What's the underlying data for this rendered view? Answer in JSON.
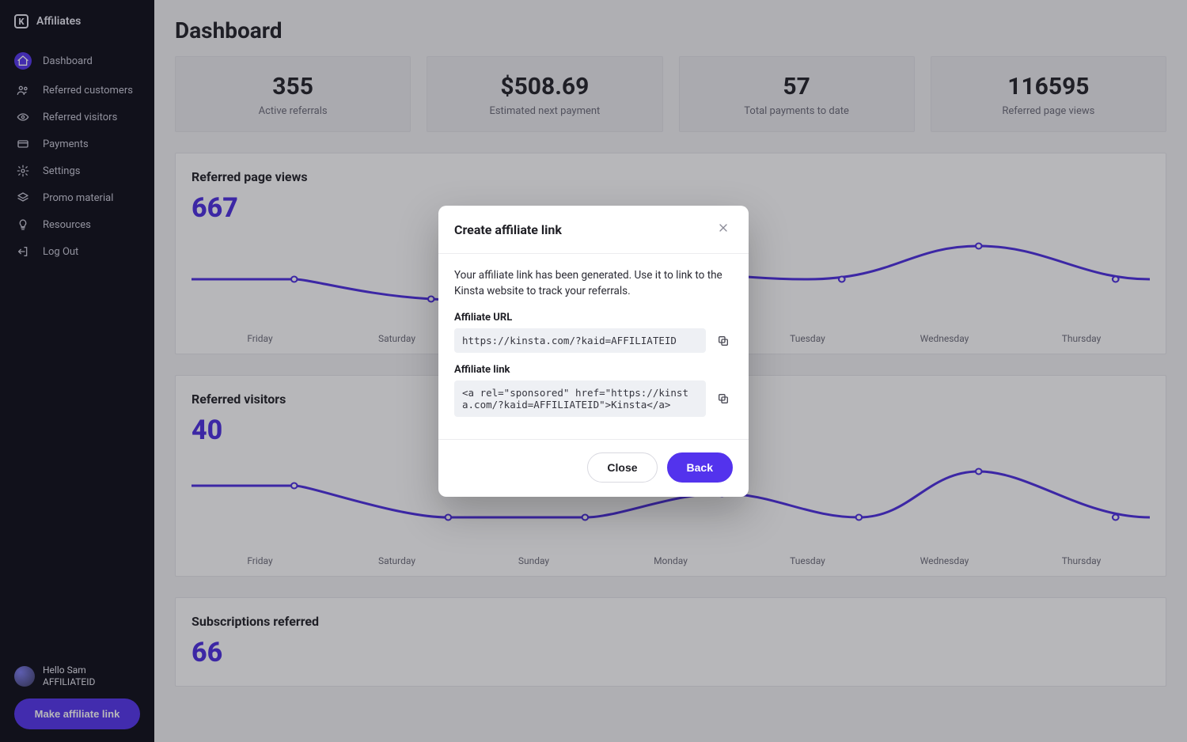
{
  "brand": {
    "name": "Affiliates"
  },
  "sidebar": {
    "items": [
      {
        "label": "Dashboard"
      },
      {
        "label": "Referred customers"
      },
      {
        "label": "Referred visitors"
      },
      {
        "label": "Payments"
      },
      {
        "label": "Settings"
      },
      {
        "label": "Promo material"
      },
      {
        "label": "Resources"
      },
      {
        "label": "Log Out"
      }
    ],
    "user": {
      "greeting": "Hello Sam",
      "id": "AFFILIATEID"
    },
    "make_link_label": "Make affiliate link"
  },
  "main": {
    "title": "Dashboard",
    "stats": [
      {
        "value": "355",
        "label": "Active referrals"
      },
      {
        "value": "$508.69",
        "label": "Estimated next payment"
      },
      {
        "value": "57",
        "label": "Total payments to date"
      },
      {
        "value": "116595",
        "label": "Referred page views"
      }
    ],
    "days": [
      "Friday",
      "Saturday",
      "Sunday",
      "Monday",
      "Tuesday",
      "Wednesday",
      "Thursday"
    ],
    "panels": {
      "page_views": {
        "title": "Referred page views",
        "value": "667"
      },
      "visitors": {
        "title": "Referred visitors",
        "value": "40"
      },
      "subscriptions": {
        "title": "Subscriptions referred",
        "value": "66"
      }
    }
  },
  "modal": {
    "title": "Create affiliate link",
    "desc": "Your affiliate link has been generated. Use it to link to the Kinsta website to track your referrals.",
    "url_label": "Affiliate URL",
    "url_value": "https://kinsta.com/?kaid=AFFILIATEID",
    "link_label": "Affiliate link",
    "link_value": "<a rel=\"sponsored\" href=\"https://kinsta.com/?kaid=AFFILIATEID\">Kinsta</a>",
    "close_label": "Close",
    "back_label": "Back"
  },
  "chart_data": [
    {
      "type": "line",
      "title": "Referred page views",
      "categories": [
        "Friday",
        "Saturday",
        "Sunday",
        "Monday",
        "Tuesday",
        "Wednesday",
        "Thursday"
      ],
      "values": [
        100,
        75,
        65,
        90,
        100,
        135,
        100
      ],
      "total": 667
    },
    {
      "type": "line",
      "title": "Referred visitors",
      "categories": [
        "Friday",
        "Saturday",
        "Sunday",
        "Monday",
        "Tuesday",
        "Wednesday",
        "Thursday"
      ],
      "values": [
        8,
        4,
        4,
        6,
        4,
        10,
        4
      ],
      "total": 40
    }
  ]
}
